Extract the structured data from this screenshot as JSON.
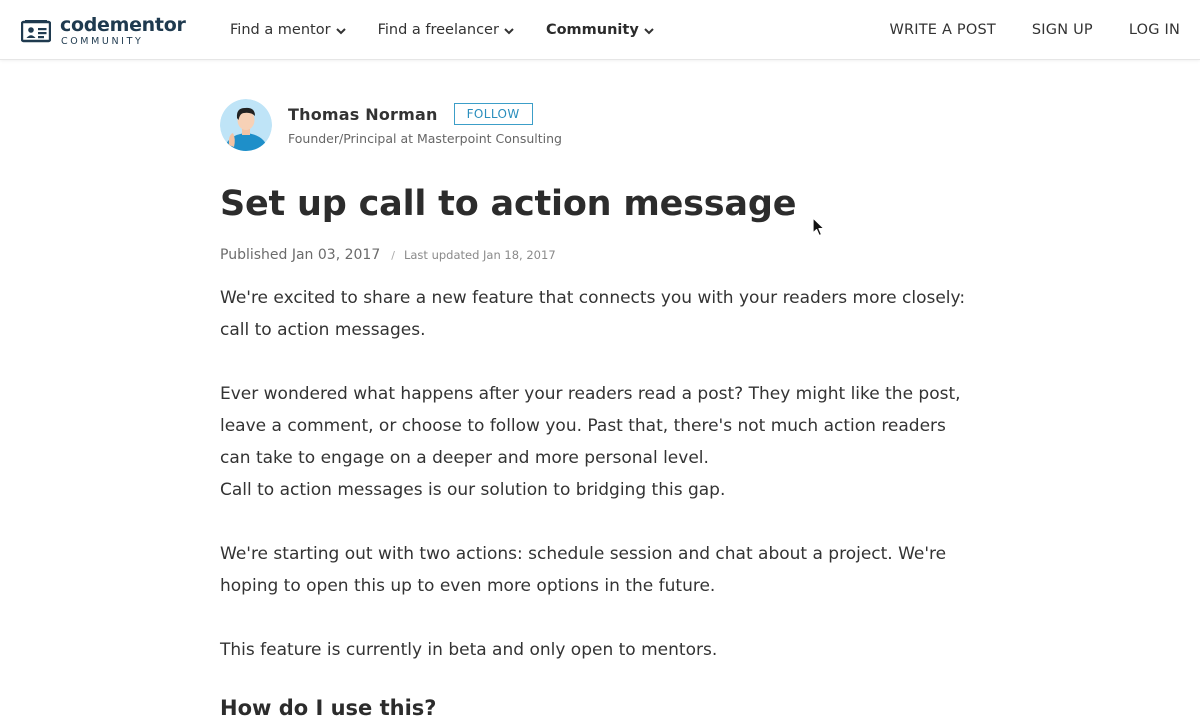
{
  "header": {
    "logo": {
      "word": "codementor",
      "sub": "COMMUNITY"
    },
    "nav": [
      {
        "label": "Find a mentor"
      },
      {
        "label": "Find a freelancer"
      },
      {
        "label": "Community"
      }
    ],
    "links": {
      "write": "WRITE A POST",
      "signup": "SIGN UP",
      "login": "LOG IN"
    }
  },
  "author": {
    "name": "Thomas Norman",
    "follow_label": "FOLLOW",
    "title": "Founder/Principal at Masterpoint Consulting"
  },
  "article": {
    "title": "Set up call to action message",
    "published": "Published Jan 03, 2017",
    "separator": "/",
    "updated": "Last updated Jan 18, 2017",
    "paragraphs": [
      "We're excited to share a new feature that connects you with your readers more closely: call to action messages.",
      "Ever wondered what happens after your readers read a post? They might like the post, leave a comment, or choose to follow you. Past that, there's not much action readers can take to engage on a deeper and more personal level.",
      "Call to action messages is our solution to bridging this gap.",
      "We're starting out with two actions: schedule session and chat about a project. We're hoping to open this up to even more options in the future.",
      "This feature is currently in beta and only open to mentors."
    ],
    "subheading": "How do I use this?"
  },
  "colors": {
    "brand": "#1f3a4f",
    "accent": "#2a8ebd",
    "text": "#333333"
  },
  "icons": {
    "logo": "codementor-logo-icon",
    "chevron": "chevron-down-icon",
    "cursor": "mouse-pointer-icon"
  }
}
